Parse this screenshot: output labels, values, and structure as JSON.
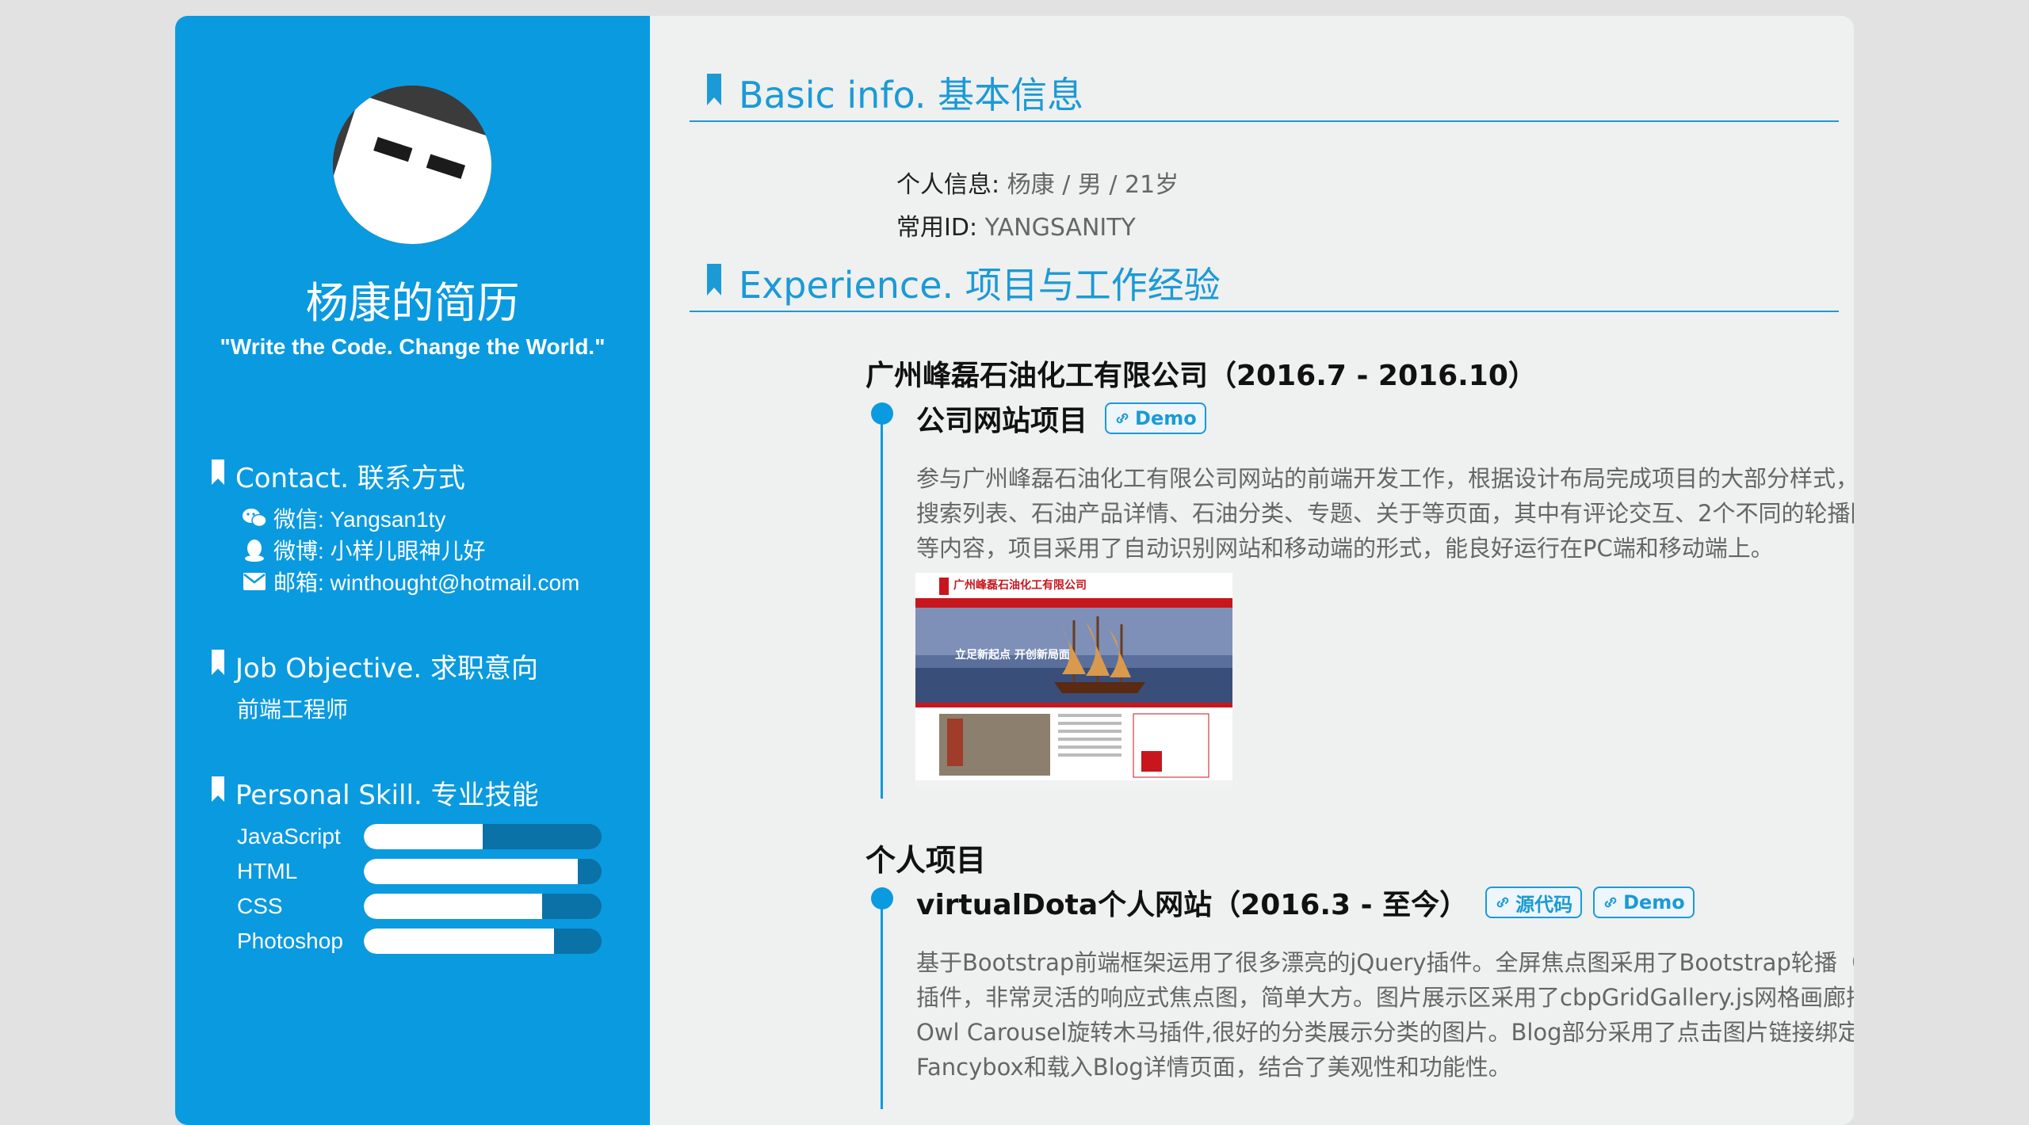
{
  "sidebar": {
    "name": "杨康的简历",
    "motto": "\"Write the Code. Change the World.\"",
    "contact": {
      "heading": "Contact. 联系方式",
      "items": [
        {
          "icon": "wechat-icon",
          "text": "微信: Yangsan1ty"
        },
        {
          "icon": "qq-icon",
          "text": "微博: 小样儿眼神儿好"
        },
        {
          "icon": "mail-icon",
          "text": "邮箱: winthought@hotmail.com"
        }
      ]
    },
    "objective": {
      "heading": "Job Objective. 求职意向",
      "value": "前端工程师"
    },
    "skills": {
      "heading": "Personal Skill. 专业技能",
      "items": [
        {
          "label": "JavaScript",
          "level": 0.5
        },
        {
          "label": "HTML",
          "level": 0.9
        },
        {
          "label": "CSS",
          "level": 0.75
        },
        {
          "label": "Photoshop",
          "level": 0.8
        }
      ]
    }
  },
  "basic": {
    "heading": "Basic info. 基本信息",
    "personal_label": "个人信息:",
    "personal_value": "杨康 / 男 / 21岁",
    "id_label": "常用ID:",
    "id_value": "YANGSANITY"
  },
  "experience": {
    "heading": "Experience. 项目与工作经验",
    "company": "广州峰磊石油化工有限公司（2016.7 - 2016.10）",
    "project1": {
      "title": "公司网站项目",
      "badge": "Demo",
      "desc": "参与广州峰磊石油化工有限公司网站的前端开发工作，根据设计布局完成项目的大部分样式，完成了首页、搜索列表、石油产品详情、石油分类、专题、关于等页面，其中有评论交互、2个不同的轮播图、搜索交互等内容，项目采用了自动识别网站和移动端的形式，能良好运行在PC端和移动端上。",
      "screenshot_text": "广州峰磊石油化工有限公司",
      "screenshot_slogan": "立足新起点 开创新局面"
    },
    "personal_heading": "个人项目",
    "project2": {
      "title": "virtualDota个人网站（2016.3 - 至今）",
      "badge_source": "源代码",
      "badge_demo": "Demo",
      "desc": "基于Bootstrap前端框架运用了很多漂亮的jQuery插件。全屏焦点图采用了Bootstrap轮播（Carousel）插件，非常灵活的响应式焦点图，简单大方。图片展示区采用了cbpGridGallery.js网格画廊插件，结合Owl Carousel旋转木马插件,很好的分类展示分类的图片。Blog部分采用了点击图片链接绑定弹出框插件-Fancybox和载入Blog详情页面，结合了美观性和功能性。"
    }
  },
  "colors": {
    "accent": "#0a9ae0",
    "heading_blue": "#1b9ad6",
    "page_bg": "#e2e2e2"
  }
}
